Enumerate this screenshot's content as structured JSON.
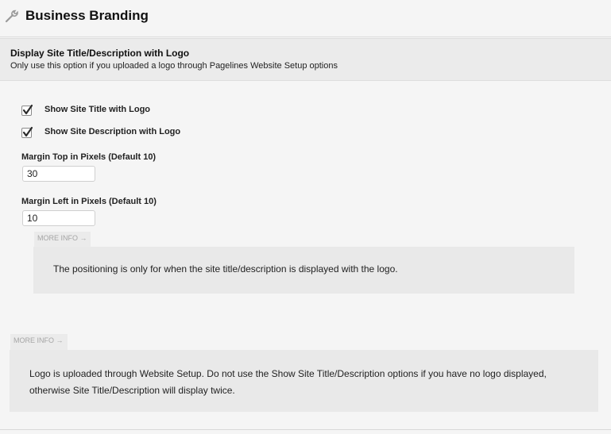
{
  "header": {
    "title": "Business Branding",
    "icon": "wrench-icon"
  },
  "section": {
    "title": "Display Site Title/Description with Logo",
    "description": "Only use this option if you uploaded a logo through Pagelines Website Setup options"
  },
  "options": {
    "show_title": {
      "label": "Show Site Title with Logo",
      "checked": true
    },
    "show_description": {
      "label": "Show Site Description with Logo",
      "checked": true
    },
    "margin_top": {
      "label": "Margin Top in Pixels (Default 10)",
      "value": "30"
    },
    "margin_left": {
      "label": "Margin Left in Pixels (Default 10)",
      "value": "10"
    }
  },
  "inner_info": {
    "toggle_label": "MORE INFO →",
    "text": "The positioning is only for when the site title/description is displayed with the logo."
  },
  "outer_info": {
    "toggle_label": "MORE INFO →",
    "text": "Logo is uploaded through Website Setup. Do not use the Show Site Title/Description options if you have no logo displayed, otherwise Site Title/Description will display twice."
  }
}
